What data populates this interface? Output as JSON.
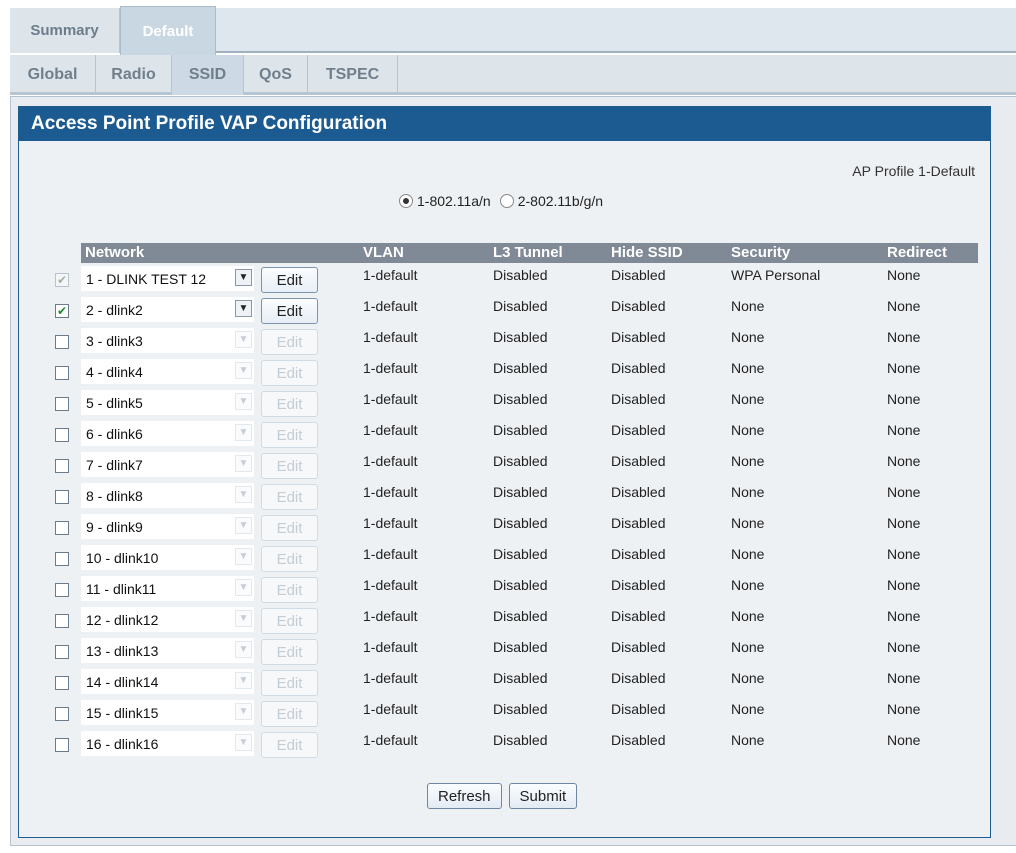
{
  "tabs": {
    "summary": "Summary",
    "default": "Default"
  },
  "subtabs": {
    "global": "Global",
    "radio": "Radio",
    "ssid": "SSID",
    "qos": "QoS",
    "tspec": "TSPEC"
  },
  "panel": {
    "title": "Access Point Profile VAP Configuration",
    "profile_label": "AP Profile 1-Default",
    "radio_a": "1-802.11a/n",
    "radio_b": "2-802.11b/g/n",
    "radio_selected": "1-802.11a/n"
  },
  "table": {
    "headers": {
      "network": "Network",
      "vlan": "VLAN",
      "l3": "L3 Tunnel",
      "hide": "Hide SSID",
      "security": "Security",
      "redirect": "Redirect"
    },
    "edit_label": "Edit",
    "rows": [
      {
        "checked": true,
        "enabled": false,
        "network": "1 - DLINK TEST 12",
        "vlan": "1-default",
        "l3": "Disabled",
        "hide": "Disabled",
        "security": "WPA Personal",
        "redirect": "None",
        "active": true
      },
      {
        "checked": true,
        "enabled": true,
        "network": "2 - dlink2",
        "vlan": "1-default",
        "l3": "Disabled",
        "hide": "Disabled",
        "security": "None",
        "redirect": "None",
        "active": true
      },
      {
        "checked": false,
        "enabled": true,
        "network": "3 - dlink3",
        "vlan": "1-default",
        "l3": "Disabled",
        "hide": "Disabled",
        "security": "None",
        "redirect": "None",
        "active": false
      },
      {
        "checked": false,
        "enabled": true,
        "network": "4 - dlink4",
        "vlan": "1-default",
        "l3": "Disabled",
        "hide": "Disabled",
        "security": "None",
        "redirect": "None",
        "active": false
      },
      {
        "checked": false,
        "enabled": true,
        "network": "5 - dlink5",
        "vlan": "1-default",
        "l3": "Disabled",
        "hide": "Disabled",
        "security": "None",
        "redirect": "None",
        "active": false
      },
      {
        "checked": false,
        "enabled": true,
        "network": "6 - dlink6",
        "vlan": "1-default",
        "l3": "Disabled",
        "hide": "Disabled",
        "security": "None",
        "redirect": "None",
        "active": false
      },
      {
        "checked": false,
        "enabled": true,
        "network": "7 - dlink7",
        "vlan": "1-default",
        "l3": "Disabled",
        "hide": "Disabled",
        "security": "None",
        "redirect": "None",
        "active": false
      },
      {
        "checked": false,
        "enabled": true,
        "network": "8 - dlink8",
        "vlan": "1-default",
        "l3": "Disabled",
        "hide": "Disabled",
        "security": "None",
        "redirect": "None",
        "active": false
      },
      {
        "checked": false,
        "enabled": true,
        "network": "9 - dlink9",
        "vlan": "1-default",
        "l3": "Disabled",
        "hide": "Disabled",
        "security": "None",
        "redirect": "None",
        "active": false
      },
      {
        "checked": false,
        "enabled": true,
        "network": "10 - dlink10",
        "vlan": "1-default",
        "l3": "Disabled",
        "hide": "Disabled",
        "security": "None",
        "redirect": "None",
        "active": false
      },
      {
        "checked": false,
        "enabled": true,
        "network": "11 - dlink11",
        "vlan": "1-default",
        "l3": "Disabled",
        "hide": "Disabled",
        "security": "None",
        "redirect": "None",
        "active": false
      },
      {
        "checked": false,
        "enabled": true,
        "network": "12 - dlink12",
        "vlan": "1-default",
        "l3": "Disabled",
        "hide": "Disabled",
        "security": "None",
        "redirect": "None",
        "active": false
      },
      {
        "checked": false,
        "enabled": true,
        "network": "13 - dlink13",
        "vlan": "1-default",
        "l3": "Disabled",
        "hide": "Disabled",
        "security": "None",
        "redirect": "None",
        "active": false
      },
      {
        "checked": false,
        "enabled": true,
        "network": "14 - dlink14",
        "vlan": "1-default",
        "l3": "Disabled",
        "hide": "Disabled",
        "security": "None",
        "redirect": "None",
        "active": false
      },
      {
        "checked": false,
        "enabled": true,
        "network": "15 - dlink15",
        "vlan": "1-default",
        "l3": "Disabled",
        "hide": "Disabled",
        "security": "None",
        "redirect": "None",
        "active": false
      },
      {
        "checked": false,
        "enabled": true,
        "network": "16 - dlink16",
        "vlan": "1-default",
        "l3": "Disabled",
        "hide": "Disabled",
        "security": "None",
        "redirect": "None",
        "active": false
      }
    ]
  },
  "buttons": {
    "refresh": "Refresh",
    "submit": "Submit"
  }
}
